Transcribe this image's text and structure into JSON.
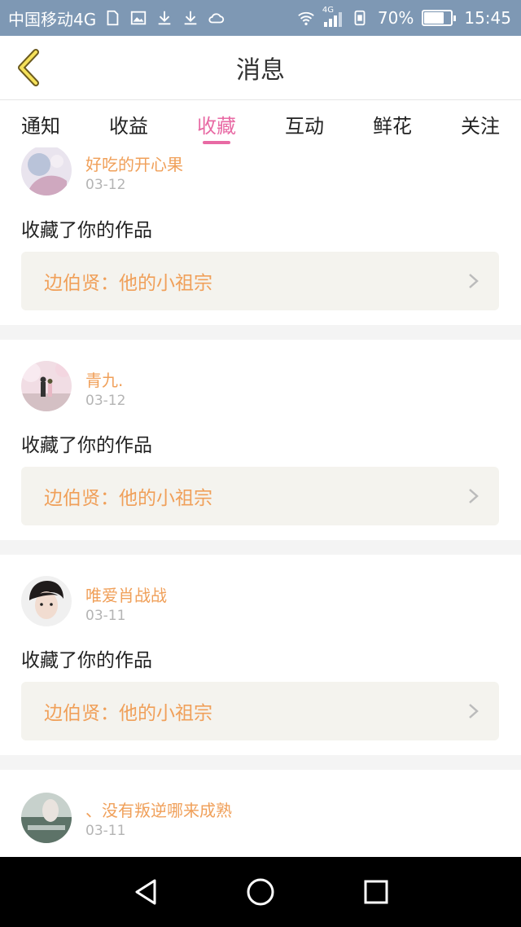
{
  "status_bar": {
    "carrier": "中国移动4G",
    "signal_label": "4G",
    "battery": "70%",
    "time": "15:45"
  },
  "header": {
    "title": "消息"
  },
  "tabs": [
    {
      "label": "通知",
      "active": false
    },
    {
      "label": "收益",
      "active": false
    },
    {
      "label": "收藏",
      "active": true
    },
    {
      "label": "互动",
      "active": false
    },
    {
      "label": "鲜花",
      "active": false
    },
    {
      "label": "关注",
      "active": false
    }
  ],
  "feed": [
    {
      "username": "好吃的开心果",
      "date": "03-12",
      "action": "收藏了你的作品",
      "work_title": "边伯贤：他的小祖宗"
    },
    {
      "username": "青九.",
      "date": "03-12",
      "action": "收藏了你的作品",
      "work_title": "边伯贤：他的小祖宗"
    },
    {
      "username": "唯爱肖战战",
      "date": "03-11",
      "action": "收藏了你的作品",
      "work_title": "边伯贤：他的小祖宗"
    },
    {
      "username": "、没有叛逆哪来成熟",
      "date": "03-11"
    }
  ],
  "colors": {
    "accent": "#e86aa4",
    "username": "#f0a05a",
    "statusbar": "#7e98b4"
  }
}
